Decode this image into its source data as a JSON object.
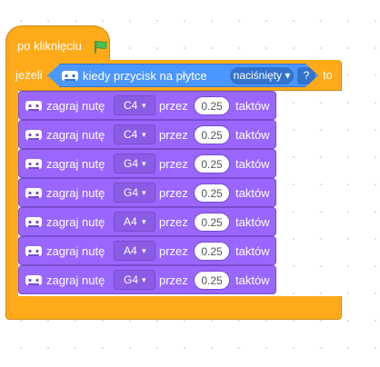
{
  "hat": {
    "label": "po kliknięciu",
    "icon": "green-flag-icon"
  },
  "if_block": {
    "if_label": "jeżeli",
    "then_label": "to",
    "condition": {
      "label": "kiedy przycisk na płytce",
      "dropdown": "naciśnięty ▾",
      "arg": "?",
      "icon": "microbit-icon"
    }
  },
  "commands": [
    {
      "label": "zagraj nutę",
      "note": "C4",
      "caret": "▾",
      "przez": "przez",
      "beats": "0.25",
      "unit": "taktów"
    },
    {
      "label": "zagraj nutę",
      "note": "C4",
      "caret": "▾",
      "przez": "przez",
      "beats": "0.25",
      "unit": "taktów"
    },
    {
      "label": "zagraj nutę",
      "note": "G4",
      "caret": "▾",
      "przez": "przez",
      "beats": "0.25",
      "unit": "taktów"
    },
    {
      "label": "zagraj nutę",
      "note": "G4",
      "caret": "▾",
      "przez": "przez",
      "beats": "0.25",
      "unit": "taktów"
    },
    {
      "label": "zagraj nutę",
      "note": "A4",
      "caret": "▾",
      "przez": "przez",
      "beats": "0.25",
      "unit": "taktów"
    },
    {
      "label": "zagraj nutę",
      "note": "A4",
      "caret": "▾",
      "przez": "przez",
      "beats": "0.25",
      "unit": "taktów"
    },
    {
      "label": "zagraj nutę",
      "note": "G4",
      "caret": "▾",
      "przez": "przez",
      "beats": "0.25",
      "unit": "taktów"
    }
  ],
  "colors": {
    "events": "#ffab19",
    "control_border": "#cf8b17",
    "condition": "#4c97ff",
    "music": "#9966ff",
    "flag": "#4cbf56"
  }
}
